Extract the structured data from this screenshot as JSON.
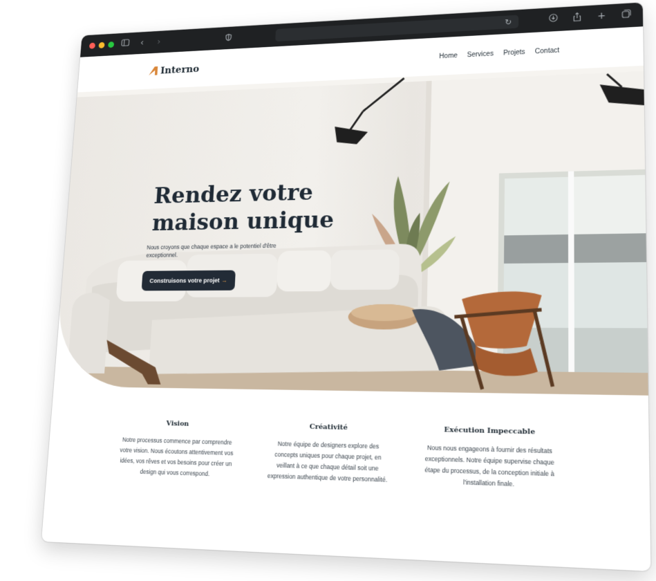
{
  "site": {
    "logo_text": "Interno",
    "nav": [
      "Home",
      "Services",
      "Projets",
      "Contact"
    ]
  },
  "hero": {
    "title_line1": "Rendez votre",
    "title_line2": "maison unique",
    "subtitle": "Nous croyons que chaque espace a le potentiel d'être exceptionnel.",
    "cta_label": "Construisons votre projet",
    "cta_arrow": "→"
  },
  "features": [
    {
      "title": "Vision",
      "text": "Notre processus commence par comprendre votre vision. Nous écoutons attentivement vos idées, vos rêves et vos besoins pour créer un design qui vous correspond."
    },
    {
      "title": "Créativité",
      "text": "Notre équipe de designers explore des concepts uniques pour chaque projet, en veillant à ce que chaque détail soit une expression authentique de votre personnalité."
    },
    {
      "title": "Exécution Impeccable",
      "text": "Nous nous engageons à fournir des résultats exceptionnels. Notre équipe supervise chaque étape du processus, de la conception initiale à l'installation finale."
    }
  ],
  "colors": {
    "accent": "#d9873a",
    "dark": "#222b36",
    "chrome": "#1f2123",
    "traffic_red": "#ff5f57",
    "traffic_yellow": "#febc2e",
    "traffic_green": "#28c840"
  },
  "icons": {
    "sidebar": "sidebar-icon",
    "back": "chevron-left-icon",
    "forward": "chevron-right-icon",
    "shield": "shield-icon",
    "reload": "reload-icon",
    "download": "download-icon",
    "share": "share-icon",
    "new_tab": "plus-icon",
    "tabs": "tabs-icon"
  }
}
